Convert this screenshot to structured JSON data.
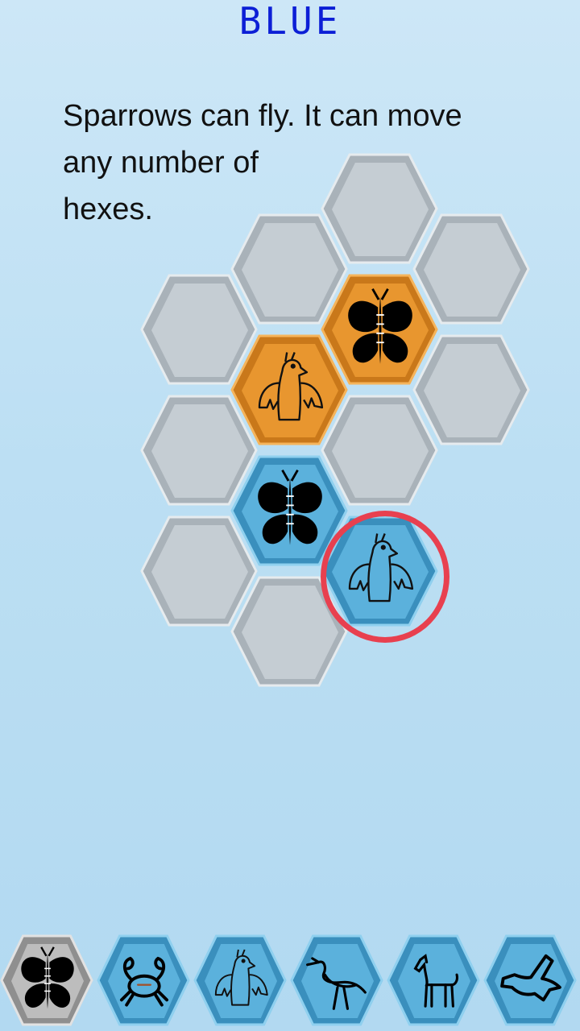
{
  "header": {
    "current_player": "BLUE"
  },
  "hint": {
    "lines": [
      "Sparrows can fly. It can move",
      "any number of",
      "hexes."
    ]
  },
  "colors": {
    "empty_hex": "#c5cdd3",
    "orange_piece": "#e8962f",
    "blue_piece": "#5bb1dc",
    "gray_piece": "#bdbdbd",
    "selection_ring": "#e8404f",
    "title": "#0c1fd6"
  },
  "board": [
    {
      "name": "hex-empty",
      "kind": "empty"
    },
    {
      "name": "hex-empty",
      "kind": "empty"
    },
    {
      "name": "hex-empty",
      "kind": "empty"
    },
    {
      "name": "hex-empty",
      "kind": "empty"
    },
    {
      "name": "hex-orange-butterfly",
      "kind": "orange",
      "icon": "butterfly-icon"
    },
    {
      "name": "hex-orange-sparrow",
      "kind": "orange",
      "icon": "sparrow-icon"
    },
    {
      "name": "hex-empty",
      "kind": "empty"
    },
    {
      "name": "hex-empty",
      "kind": "empty"
    },
    {
      "name": "hex-empty",
      "kind": "empty"
    },
    {
      "name": "hex-blue-butterfly",
      "kind": "blue",
      "icon": "butterfly-icon"
    },
    {
      "name": "hex-empty",
      "kind": "empty"
    },
    {
      "name": "hex-blue-sparrow-selected",
      "kind": "blue",
      "icon": "sparrow-icon",
      "selected": true
    },
    {
      "name": "hex-empty",
      "kind": "empty"
    }
  ],
  "tray": [
    {
      "name": "tray-butterfly",
      "icon": "butterfly-icon",
      "kind": "gray"
    },
    {
      "name": "tray-crab",
      "icon": "crab-icon",
      "kind": "blue"
    },
    {
      "name": "tray-sparrow",
      "icon": "sparrow-icon",
      "kind": "blue"
    },
    {
      "name": "tray-heron",
      "icon": "heron-icon",
      "kind": "blue"
    },
    {
      "name": "tray-horse",
      "icon": "horse-icon",
      "kind": "blue"
    },
    {
      "name": "tray-dove",
      "icon": "dove-icon",
      "kind": "blue"
    }
  ]
}
